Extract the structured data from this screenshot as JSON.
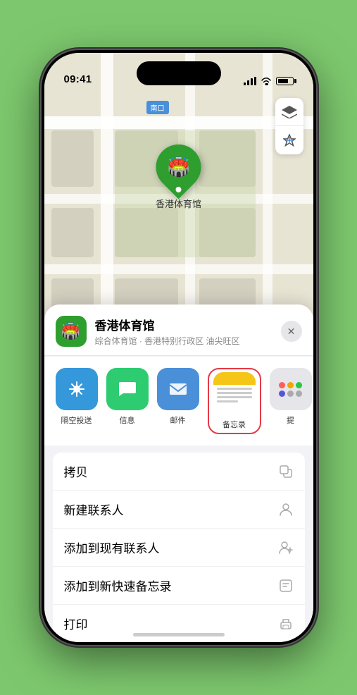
{
  "status": {
    "time": "09:41",
    "time_icon": "location-arrow"
  },
  "map": {
    "road_label": "南口",
    "road_prefix": "南口"
  },
  "venue": {
    "name": "香港体育馆",
    "subtitle": "综合体育馆 · 香港特别行政区 油尖旺区",
    "icon": "🏟️"
  },
  "share_items": [
    {
      "id": "airdrop",
      "label": "隔空投送",
      "icon": "airdrop"
    },
    {
      "id": "messages",
      "label": "信息",
      "icon": "messages"
    },
    {
      "id": "mail",
      "label": "邮件",
      "icon": "mail"
    },
    {
      "id": "notes",
      "label": "备忘录",
      "icon": "notes"
    },
    {
      "id": "more",
      "label": "提",
      "icon": "more"
    }
  ],
  "actions": [
    {
      "id": "copy",
      "label": "拷贝",
      "icon": "copy"
    },
    {
      "id": "new-contact",
      "label": "新建联系人",
      "icon": "person"
    },
    {
      "id": "add-existing",
      "label": "添加到现有联系人",
      "icon": "person-add"
    },
    {
      "id": "add-notes",
      "label": "添加到新快速备忘录",
      "icon": "note"
    },
    {
      "id": "print",
      "label": "打印",
      "icon": "print"
    }
  ],
  "pin_label": "香港体育馆"
}
